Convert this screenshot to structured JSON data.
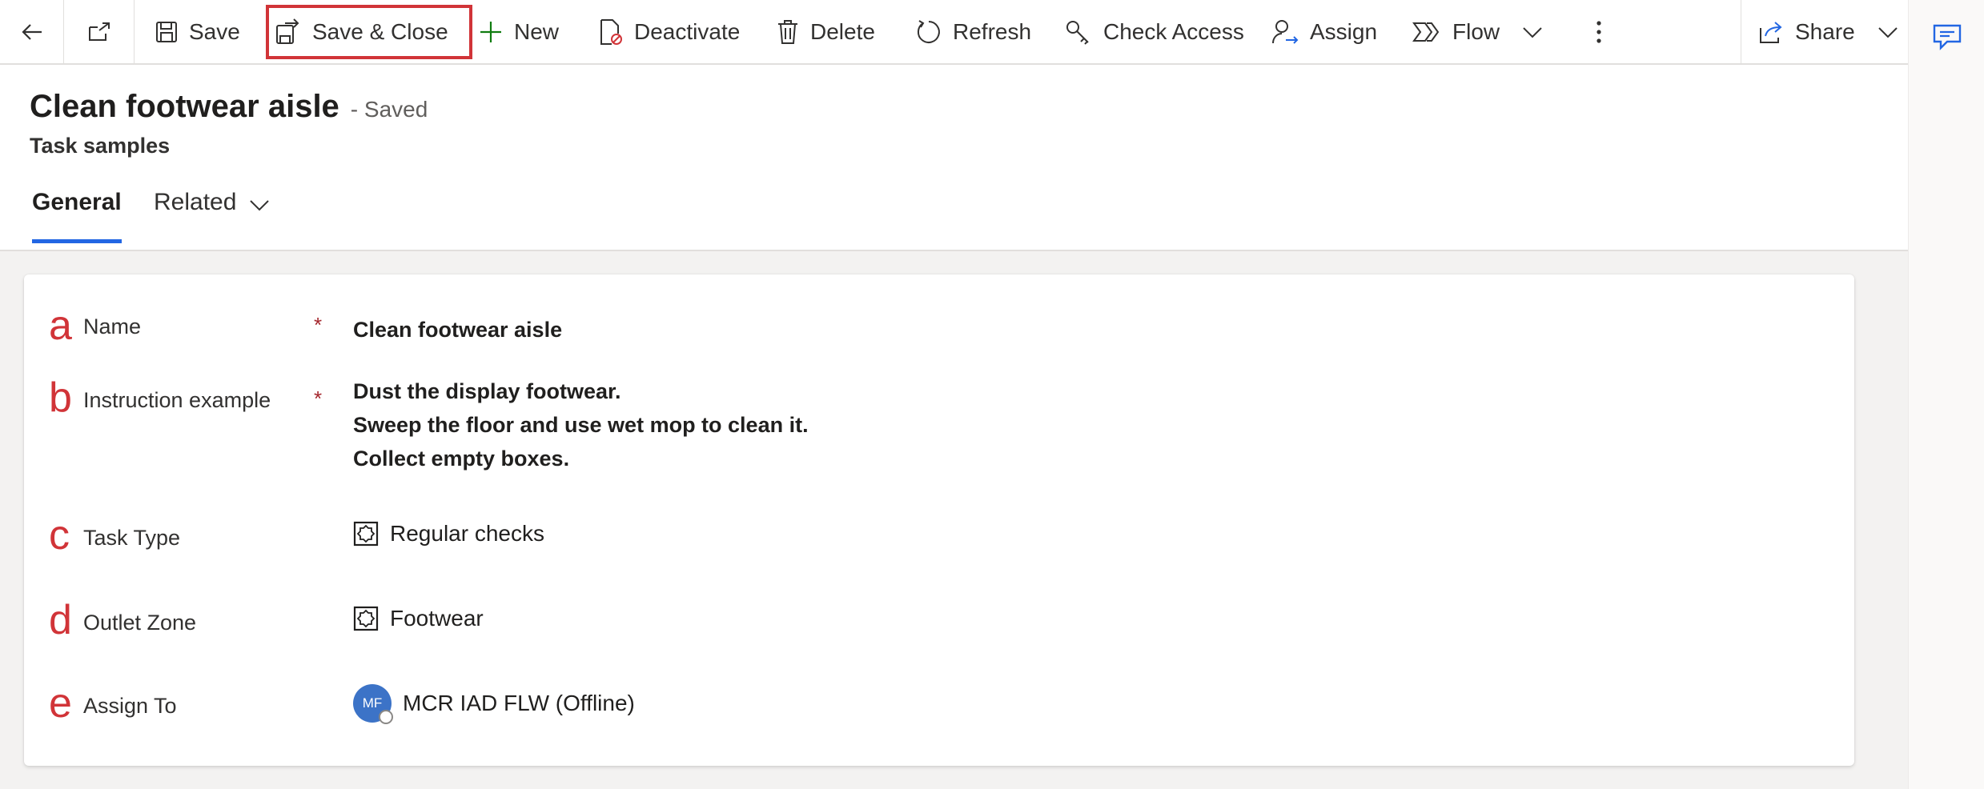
{
  "toolbar": {
    "save": "Save",
    "save_close": "Save & Close",
    "new": "New",
    "deactivate": "Deactivate",
    "delete": "Delete",
    "refresh": "Refresh",
    "check_access": "Check Access",
    "assign": "Assign",
    "flow": "Flow",
    "share": "Share"
  },
  "header": {
    "title": "Clean footwear aisle",
    "status": "- Saved",
    "entity": "Task samples"
  },
  "tabs": {
    "general": "General",
    "related": "Related"
  },
  "fields": [
    {
      "letter": "a",
      "label": "Name",
      "required": "*",
      "value": "Clean footwear aisle"
    },
    {
      "letter": "b",
      "label": "Instruction example",
      "required": "*",
      "lines": [
        "Dust the display footwear.",
        "Sweep the floor and use wet mop to clean it.",
        "Collect empty boxes."
      ]
    },
    {
      "letter": "c",
      "label": "Task Type",
      "value": "Regular checks"
    },
    {
      "letter": "d",
      "label": "Outlet Zone",
      "value": "Footwear"
    },
    {
      "letter": "e",
      "label": "Assign To",
      "value": "MCR IAD FLW (Offline)",
      "initials": "MF"
    }
  ],
  "colors": {
    "accent": "#2266e3",
    "annotation": "#d13438",
    "required": "#a4262c",
    "new_plus": "#107c10"
  }
}
